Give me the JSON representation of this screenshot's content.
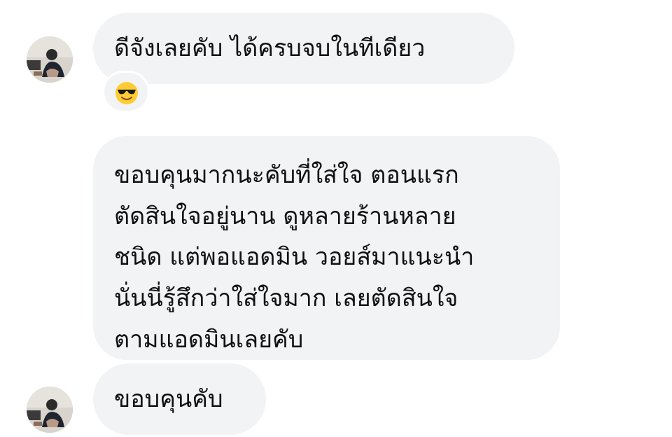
{
  "messages": [
    {
      "text": "ดีจังเลยคับ ได้ครบจบในทีเดียว",
      "reaction": "smiling-face-with-sunglasses"
    },
    {
      "lines": [
        "ขอบคุนมากนะคับที่ใส่ใจ ตอนแรก",
        "ตัดสินใจอยู่นาน ดูหลายร้านหลาย",
        "ชนิด แต่พอแอดมิน วอยส์มาแนะนำ",
        "นั่นนี่รู้สึกว่าใส่ใจมาก เลยตัดสินใจ",
        "ตามแอดมินเลยคับ"
      ]
    },
    {
      "text": "ขอบคุนคับ"
    }
  ],
  "colors": {
    "bubble": "#f2f3f5",
    "text": "#111111",
    "background": "#ffffff"
  }
}
